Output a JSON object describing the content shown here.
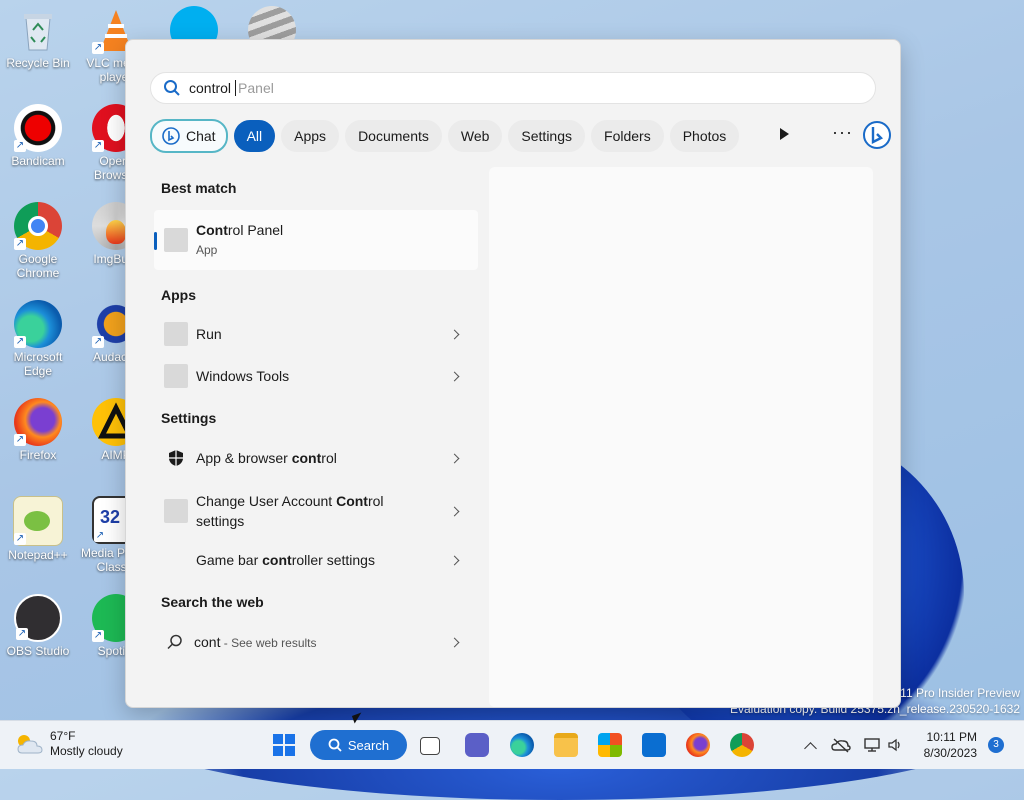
{
  "desktop": {
    "icons": [
      {
        "label": "Recycle Bin"
      },
      {
        "label": "VLC media player"
      },
      {
        "label": "Bandicam"
      },
      {
        "label": "Opera Browser"
      },
      {
        "label": "Google Chrome"
      },
      {
        "label": "ImgBurn"
      },
      {
        "label": "Microsoft Edge"
      },
      {
        "label": "Audacity"
      },
      {
        "label": "Firefox"
      },
      {
        "label": "AIMP"
      },
      {
        "label": "Notepad++"
      },
      {
        "label": "Media Player Classic"
      },
      {
        "label": "OBS Studio"
      },
      {
        "label": "Spotify"
      }
    ]
  },
  "search": {
    "typed": "control",
    "ghost": "Panel"
  },
  "filters": {
    "chat": "Chat",
    "all": "All",
    "apps": "Apps",
    "documents": "Documents",
    "web": "Web",
    "settings": "Settings",
    "folders": "Folders",
    "photos": "Photos"
  },
  "best_match": {
    "heading": "Best match",
    "title_bold": "Cont",
    "title_rest": "rol Panel",
    "subtitle": "App"
  },
  "apps": {
    "heading": "Apps",
    "items": [
      {
        "label": "Run"
      },
      {
        "label": "Windows Tools"
      }
    ]
  },
  "settings": {
    "heading": "Settings",
    "items": [
      {
        "pre": "App & browser ",
        "bold": "cont",
        "post": "rol"
      },
      {
        "pre": "Change User Account ",
        "bold": "Cont",
        "post": "rol",
        "line2": "settings"
      },
      {
        "pre": "Game bar ",
        "bold": "cont",
        "post": "roller settings"
      }
    ]
  },
  "web": {
    "heading": "Search the web",
    "query": "cont",
    "suffix": " - See web results"
  },
  "watermark": {
    "line1": "11 Pro Insider Preview",
    "line2": "Evaluation copy. Build 25375.zn_release.230520-1632"
  },
  "taskbar": {
    "temperature": "67°F",
    "condition": "Mostly cloudy",
    "search_label": "Search",
    "time": "10:11 PM",
    "date": "8/30/2023",
    "notification_count": "3"
  }
}
